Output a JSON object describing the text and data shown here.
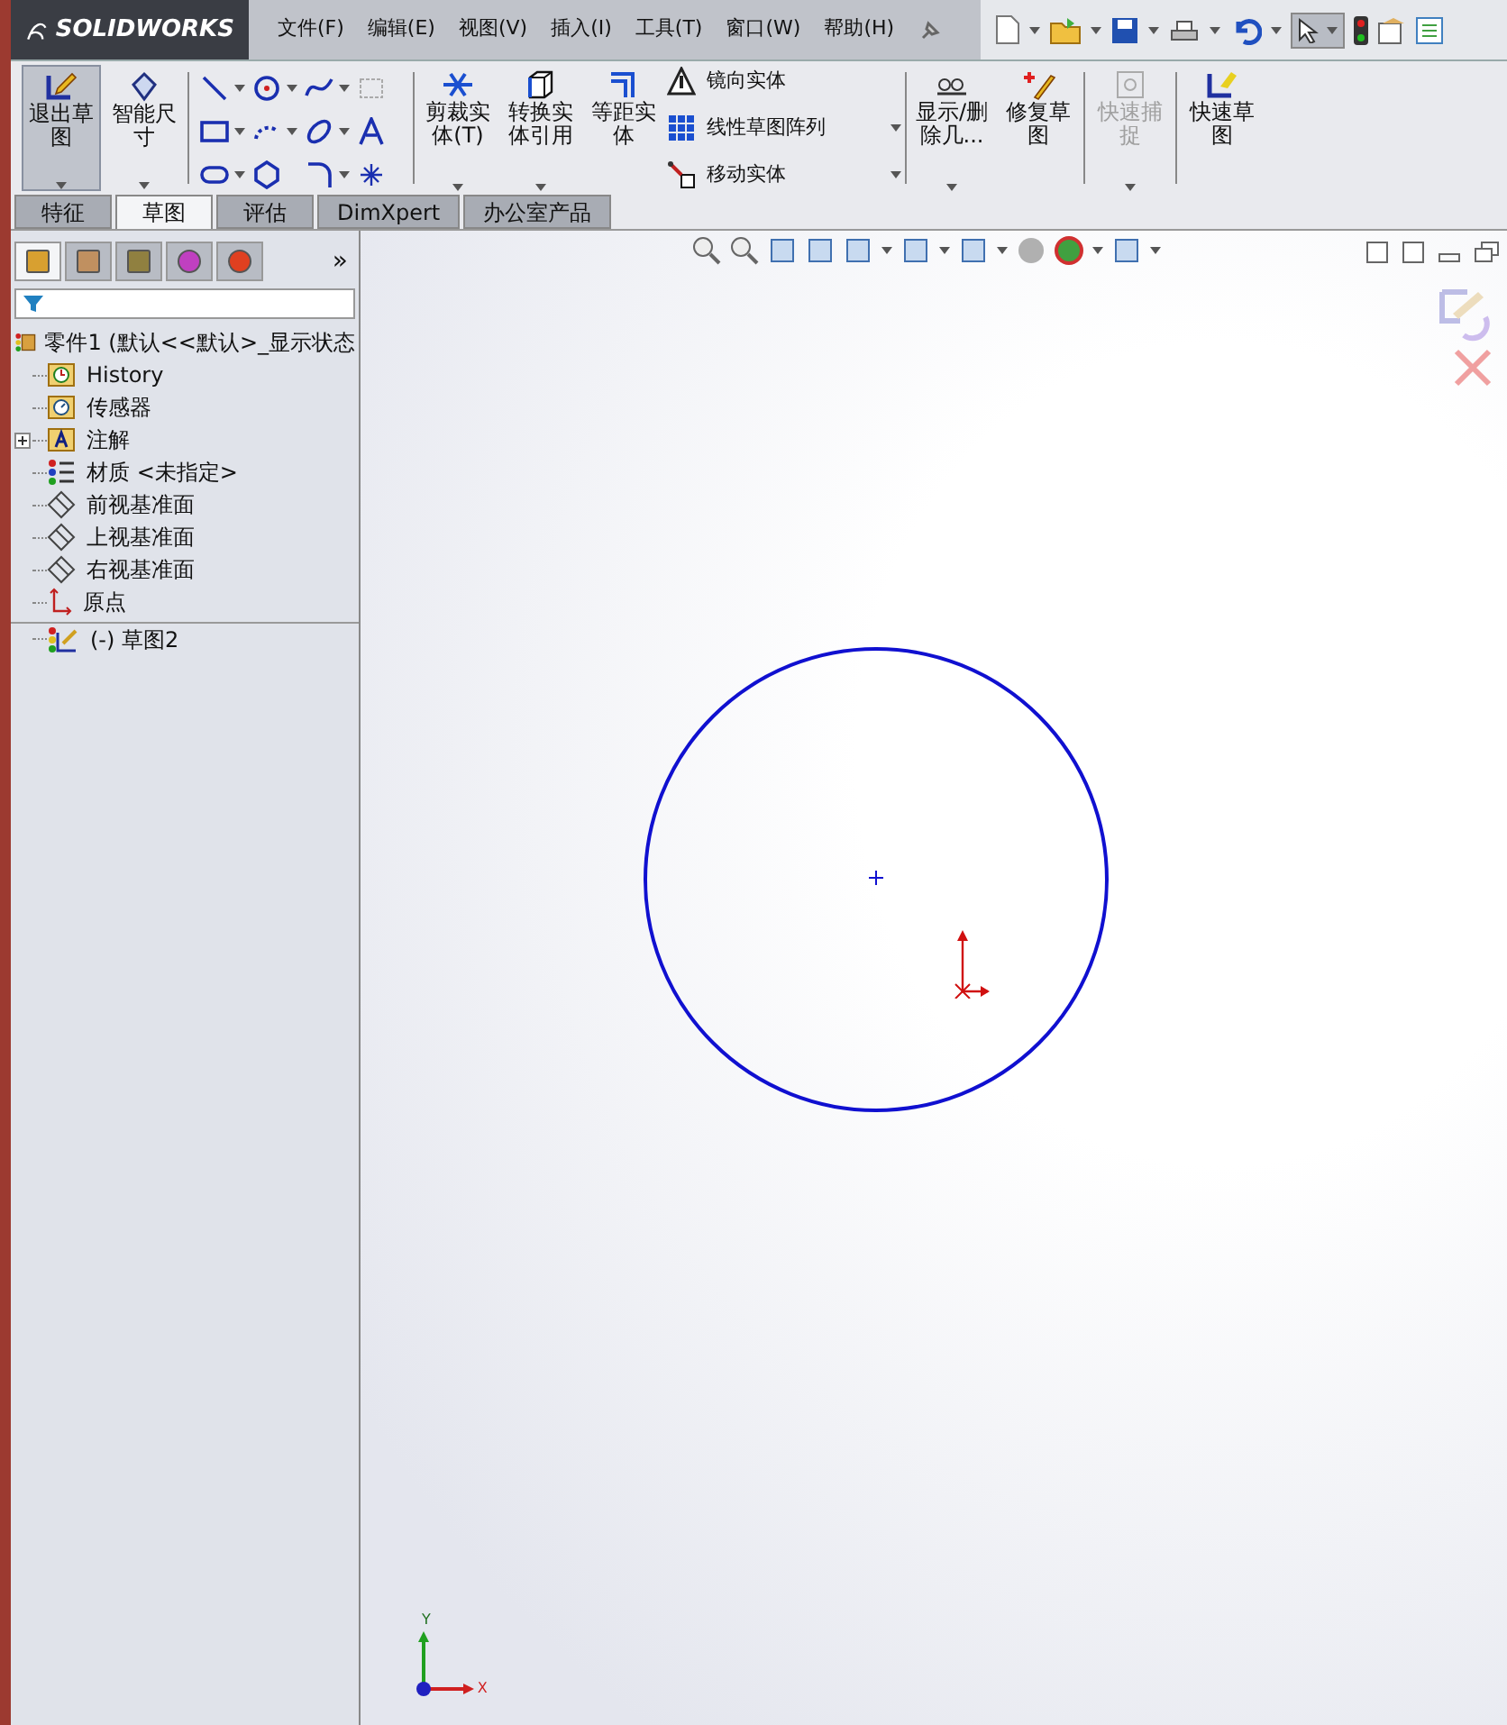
{
  "app": {
    "logo": "SOLIDWORKS"
  },
  "menu": [
    "文件(F)",
    "编辑(E)",
    "视图(V)",
    "插入(I)",
    "工具(T)",
    "窗口(W)",
    "帮助(H)"
  ],
  "ribbon": {
    "big_buttons": [
      {
        "label": "退出草图",
        "pressed": true,
        "disabled": false
      },
      {
        "label": "智能尺寸",
        "pressed": false,
        "disabled": false
      }
    ],
    "tool_buttons": [
      {
        "label": "剪裁实体(T)",
        "disabled": false
      },
      {
        "label": "转换实体引用",
        "disabled": false
      },
      {
        "label": "等距实体",
        "disabled": false
      }
    ],
    "list_buttons": [
      "镜向实体",
      "线性草图阵列",
      "移动实体"
    ],
    "extra_buttons": [
      {
        "label": "显示/删除几...",
        "disabled": false
      },
      {
        "label": "修复草图",
        "disabled": false
      },
      {
        "label": "快速捕捉",
        "disabled": true
      },
      {
        "label": "快速草图",
        "disabled": false
      }
    ]
  },
  "tabs": [
    {
      "label": "特征",
      "selected": false
    },
    {
      "label": "草图",
      "selected": true
    },
    {
      "label": "评估",
      "selected": false
    },
    {
      "label": "DimXpert",
      "selected": false
    },
    {
      "label": "办公室产品",
      "selected": false
    }
  ],
  "tree": {
    "root": "零件1  (默认<<默认>_显示状态",
    "children": [
      {
        "label": "History",
        "kind": "history",
        "collapsed": false
      },
      {
        "label": "传感器",
        "kind": "sensor",
        "collapsed": false
      },
      {
        "label": "注解",
        "kind": "annotation",
        "collapsed": true
      },
      {
        "label": "材质 <未指定>",
        "kind": "material",
        "collapsed": false
      },
      {
        "label": "前视基准面",
        "kind": "plane",
        "collapsed": false
      },
      {
        "label": "上视基准面",
        "kind": "plane",
        "collapsed": false
      },
      {
        "label": "右视基准面",
        "kind": "plane",
        "collapsed": false
      },
      {
        "label": "原点",
        "kind": "origin",
        "collapsed": false
      },
      {
        "label": "(-) 草图2",
        "kind": "sketch",
        "collapsed": false
      }
    ]
  },
  "panel": {
    "more": "»",
    "tabs": [
      {
        "selected": true
      },
      {
        "selected": false
      },
      {
        "selected": false
      },
      {
        "selected": false
      },
      {
        "selected": false
      }
    ]
  },
  "triad": {
    "x": "X",
    "y": "Y"
  }
}
